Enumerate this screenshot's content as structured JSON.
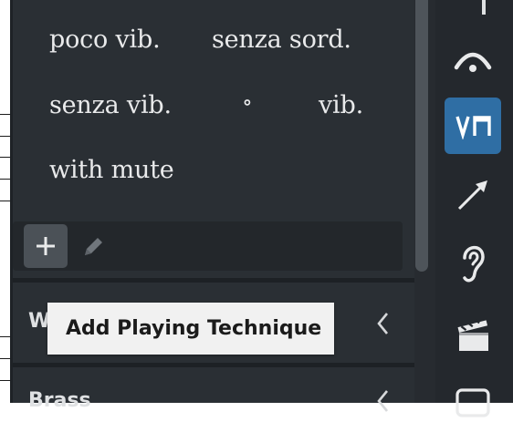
{
  "techniques": [
    "poco vib.",
    "senza sord.",
    "senza vib.",
    "∘",
    "vib.",
    "with mute"
  ],
  "toolbar": {
    "add_icon": "plus-icon",
    "edit_icon": "pencil-icon"
  },
  "sections": [
    {
      "label": "Wind",
      "icon": "chevron-left-icon"
    },
    {
      "label": "Brass",
      "icon": "chevron-left-icon"
    }
  ],
  "tooltip": {
    "text": "Add Playing Technique"
  },
  "rail": {
    "items": [
      {
        "icon": "rehearsal-mark-icon",
        "active": false
      },
      {
        "icon": "fermata-icon",
        "active": false
      },
      {
        "icon": "playing-techniques-icon",
        "label": "V⊓",
        "active": true
      },
      {
        "icon": "line-arrow-icon",
        "active": false
      },
      {
        "icon": "ear-icon",
        "active": false
      },
      {
        "icon": "clapperboard-icon",
        "active": false
      },
      {
        "icon": "frame-icon",
        "active": false
      }
    ]
  },
  "colors": {
    "panel_bg": "#2a2f34",
    "rail_bg": "#24282d",
    "accent": "#2f6ea4",
    "tooltip_bg": "#f1f1f1",
    "text": "#e9eaeb"
  }
}
